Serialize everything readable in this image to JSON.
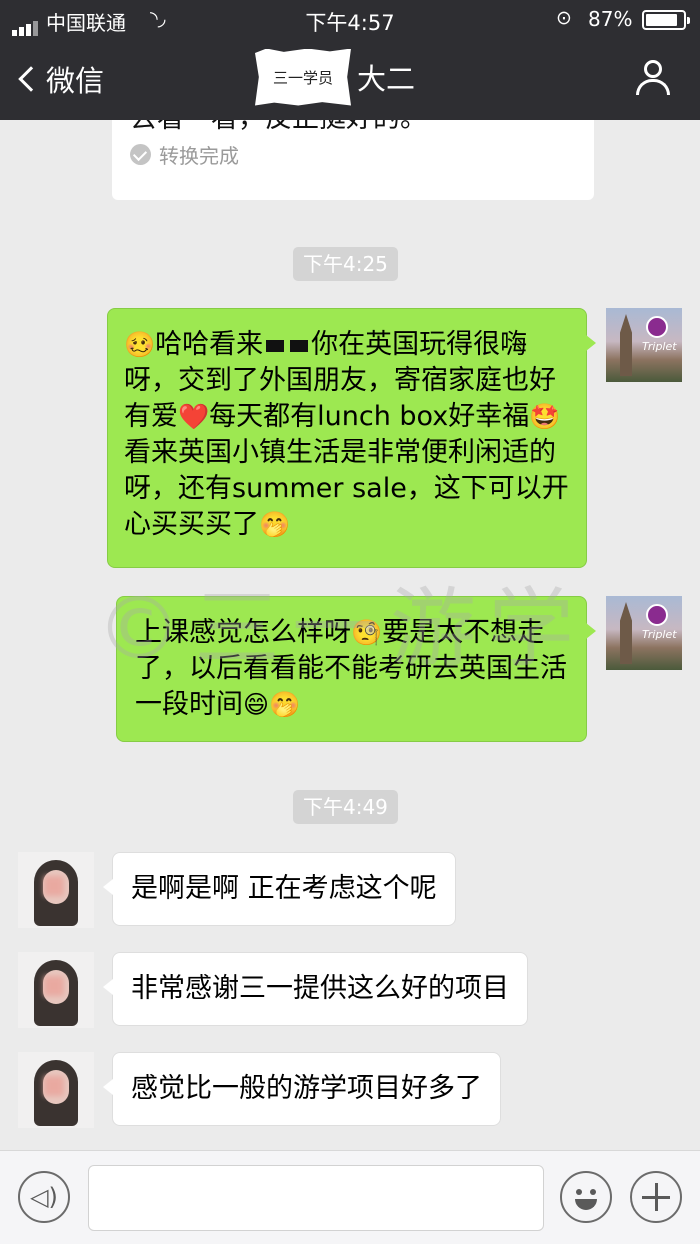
{
  "status_bar": {
    "carrier": "中国联通",
    "time": "下午4:57",
    "battery_percent": "87%",
    "battery_level": 0.87
  },
  "nav": {
    "back_label": "微信",
    "title_sticker": "三一学员",
    "title_suffix": "大二"
  },
  "voice_card": {
    "partial_text": "去看一看，反正挺好的。",
    "status": "转换完成"
  },
  "timestamps": [
    "下午4:25",
    "下午4:49"
  ],
  "messages": {
    "m1_parts": {
      "a": "哈哈看来",
      "b": "你在英国玩得很嗨呀，交到了外国朋友，寄宿家庭也好有爱",
      "c": "每天都有lunch box好幸福",
      "d": "看来英国小镇生活是非常便利闲适的呀，还有summer sale，这下可以开心买买买了"
    },
    "m2_parts": {
      "a": "上课感觉怎么样呀",
      "b": "要是太不想走了，以后看看能不能考研去英国生活一段时间"
    },
    "reply1": "是啊是啊 正在考虑这个呢",
    "reply2": "非常感谢三一提供这么好的项目",
    "reply3": "感觉比一般的游学项目好多了"
  },
  "avatar_brand": "Triplet",
  "watermark": "©三一游学",
  "icons": {
    "emoji_face": "🥴",
    "heart": "❤️",
    "star_eyes": "🤩",
    "thinking": "🤭",
    "smirk": "🧐",
    "grin": "😄"
  }
}
